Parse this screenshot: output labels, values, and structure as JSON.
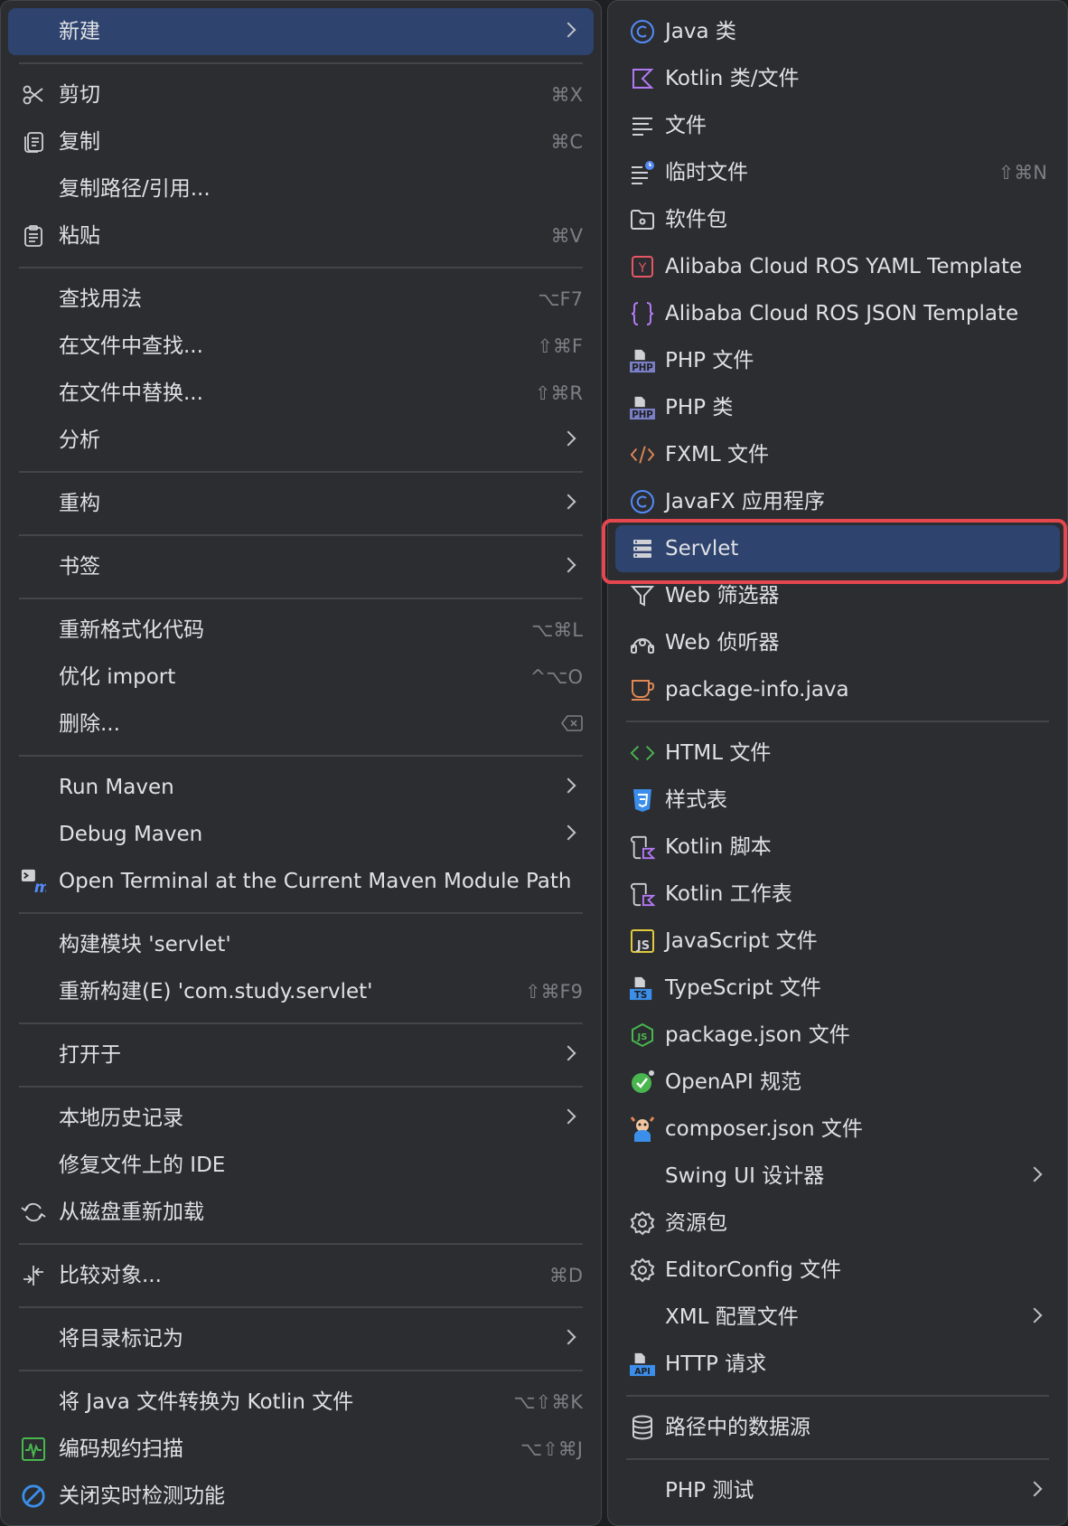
{
  "left_menu": {
    "new": "新建",
    "cut": {
      "label": "剪切",
      "shortcut": "⌘X"
    },
    "copy": {
      "label": "复制",
      "shortcut": "⌘C"
    },
    "copy_path": "复制路径/引用...",
    "paste": {
      "label": "粘贴",
      "shortcut": "⌘V"
    },
    "find_usages": {
      "label": "查找用法",
      "shortcut": "⌥F7"
    },
    "find_in_files": {
      "label": "在文件中查找...",
      "shortcut": "⇧⌘F"
    },
    "replace_in_files": {
      "label": "在文件中替换...",
      "shortcut": "⇧⌘R"
    },
    "analyze": "分析",
    "refactor": "重构",
    "bookmarks": "书签",
    "reformat": {
      "label": "重新格式化代码",
      "shortcut": "⌥⌘L"
    },
    "optimize_imports": {
      "label": "优化 import",
      "shortcut": "^⌥O"
    },
    "delete": {
      "label": "删除..."
    },
    "run_maven": "Run Maven",
    "debug_maven": "Debug Maven",
    "open_terminal": "Open Terminal at the Current Maven Module Path",
    "build_module": "构建模块 'servlet'",
    "rebuild": {
      "label": "重新构建(E) 'com.study.servlet'",
      "shortcut": "⇧⌘F9"
    },
    "open_in": "打开于",
    "local_history": "本地历史记录",
    "repair_ide": "修复文件上的 IDE",
    "reload_from_disk": "从磁盘重新加载",
    "compare_with": {
      "label": "比较对象...",
      "shortcut": "⌘D"
    },
    "mark_directory_as": "将目录标记为",
    "convert_java_kotlin": {
      "label": "将 Java 文件转换为 Kotlin 文件",
      "shortcut": "⌥⇧⌘K"
    },
    "code_scan": {
      "label": "编码规约扫描",
      "shortcut": "⌥⇧⌘J"
    },
    "close_realtime": "关闭实时检测功能"
  },
  "right_menu": {
    "java_class": "Java 类",
    "kotlin_class": "Kotlin 类/文件",
    "file": "文件",
    "scratch": {
      "label": "临时文件",
      "shortcut": "⇧⌘N"
    },
    "package": "软件包",
    "ros_yaml": "Alibaba Cloud ROS YAML Template",
    "ros_json": "Alibaba Cloud ROS JSON Template",
    "php_file": "PHP 文件",
    "php_class": "PHP 类",
    "fxml_file": "FXML 文件",
    "javafx_app": "JavaFX 应用程序",
    "servlet": "Servlet",
    "web_filter": "Web 筛选器",
    "web_listener": "Web 侦听器",
    "package_info": "package-info.java",
    "html_file": "HTML 文件",
    "stylesheet": "样式表",
    "kotlin_script": "Kotlin 脚本",
    "kotlin_worksheet": "Kotlin 工作表",
    "javascript_file": "JavaScript 文件",
    "typescript_file": "TypeScript 文件",
    "package_json": "package.json 文件",
    "openapi": "OpenAPI 规范",
    "composer_json": "composer.json 文件",
    "swing_ui": "Swing UI 设计器",
    "resource_bundle": "资源包",
    "editorconfig": "EditorConfig 文件",
    "xml_config": "XML 配置文件",
    "http_request": "HTTP 请求",
    "datasource": "路径中的数据源",
    "php_test": "PHP 测试"
  },
  "icon_text": {
    "php": "PHP",
    "js": "JS",
    "ts": "TS",
    "api": "API",
    "yaml": "Y",
    "m": "m"
  },
  "colors": {
    "selected": "#2e436e",
    "highlight": "#e5474f",
    "menu_bg": "#2b2d30",
    "java": "#548af7",
    "kotlin": "#b379f5"
  }
}
